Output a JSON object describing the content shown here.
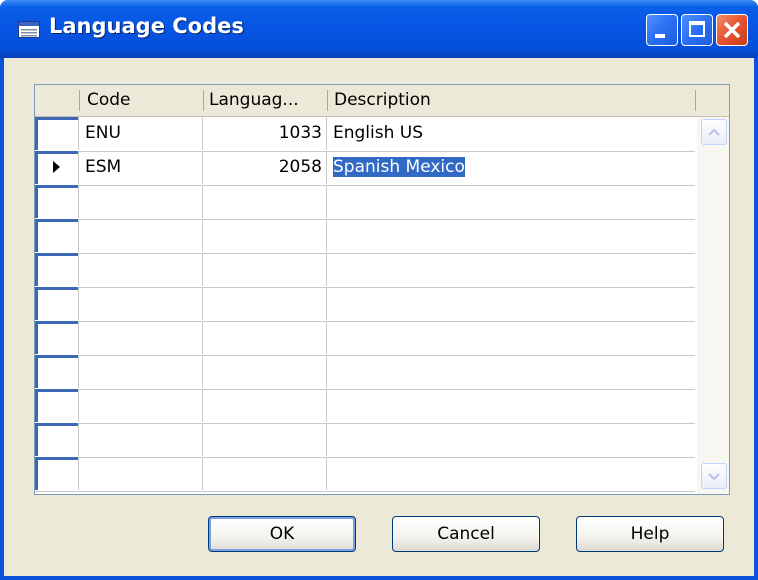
{
  "window": {
    "title": "Language Codes",
    "icon": "table-icon"
  },
  "title_buttons": {
    "minimize_icon": "minimize-icon",
    "maximize_icon": "maximize-icon",
    "close_icon": "close-icon"
  },
  "grid": {
    "columns": [
      "Code",
      "Languag...",
      "Description"
    ],
    "rows": [
      {
        "code": "ENU",
        "language_id": "1033",
        "description": "English US",
        "current": false
      },
      {
        "code": "ESM",
        "language_id": "2058",
        "description": "Spanish Mexico",
        "current": true
      }
    ],
    "empty_rows": 9,
    "selection_color": "#316ac5"
  },
  "buttons": {
    "ok": "OK",
    "cancel": "Cancel",
    "help": "Help"
  }
}
